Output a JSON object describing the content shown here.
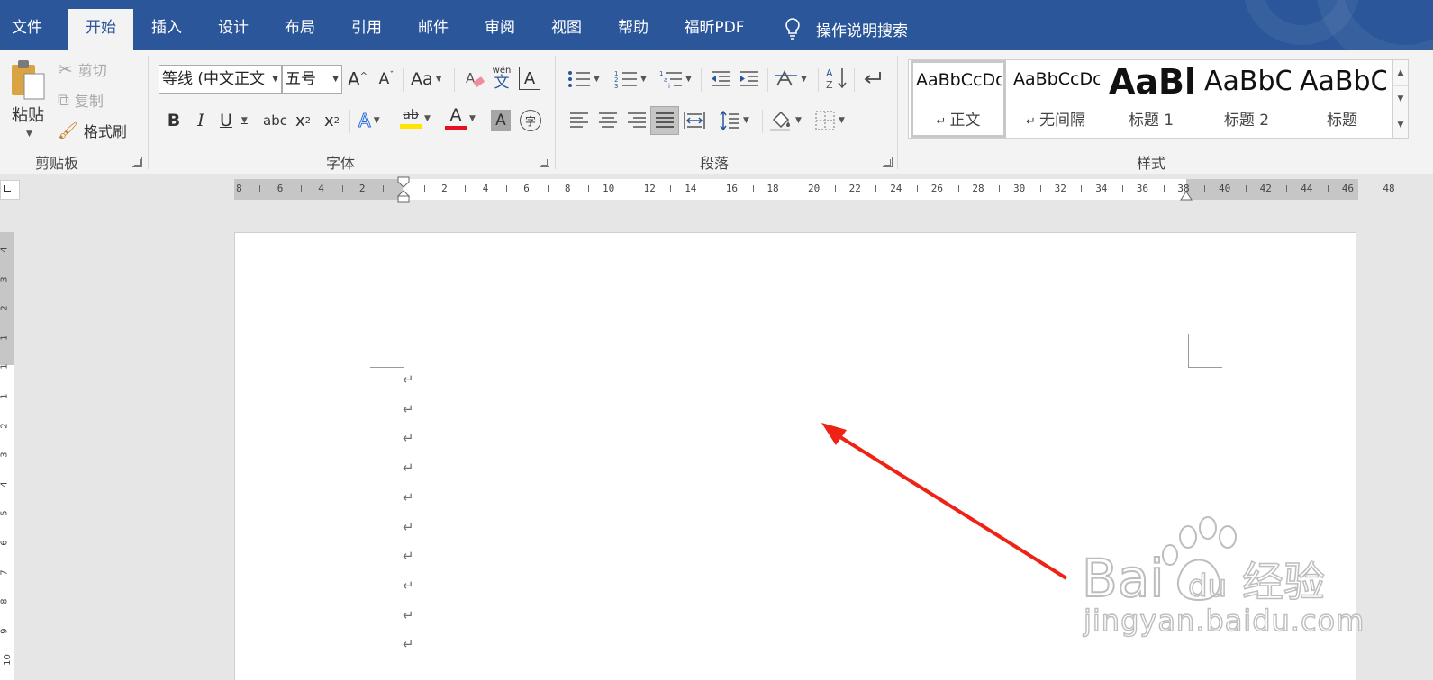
{
  "menu": {
    "tabs": [
      "文件",
      "开始",
      "插入",
      "设计",
      "布局",
      "引用",
      "邮件",
      "审阅",
      "视图",
      "帮助",
      "福昕PDF"
    ],
    "active": "开始",
    "tell_me": "操作说明搜索"
  },
  "clipboard": {
    "paste": "粘贴",
    "cut": "剪切",
    "copy": "复制",
    "format_painter": "格式刷",
    "group": "剪贴板"
  },
  "font": {
    "name": "等线 (中文正文",
    "size": "五号",
    "buttons": {
      "bold": "B",
      "italic": "I",
      "underline": "U",
      "strike": "abc",
      "sub": "x",
      "sup": "x",
      "case": "Aa",
      "pinyin_top": "wén",
      "pinyin_bottom": "文",
      "border": "A",
      "effects": "A",
      "highlight": "ab",
      "color": "A",
      "shading": "A",
      "enclose": "字"
    },
    "group": "字体"
  },
  "paragraph": {
    "group": "段落"
  },
  "styles": {
    "items": [
      {
        "preview": "AaBbCcDc",
        "name": "正文",
        "selected": true
      },
      {
        "preview": "AaBbCcDc",
        "name": "无间隔"
      },
      {
        "preview": "AaBl",
        "name": "标题 1"
      },
      {
        "preview": "AaBbC",
        "name": "标题 2"
      },
      {
        "preview": "AaBbC",
        "name": "标题"
      }
    ],
    "group": "样式"
  },
  "ruler": {
    "numbers": [
      "8",
      "6",
      "4",
      "2",
      "2",
      "4",
      "6",
      "8",
      "10",
      "12",
      "14",
      "16",
      "18",
      "20",
      "22",
      "24",
      "26",
      "28",
      "30",
      "32",
      "34",
      "36",
      "38",
      "40",
      "42",
      "44",
      "46",
      "48"
    ],
    "vertical_numbers": [
      "4",
      "3",
      "2",
      "1",
      "1",
      "1",
      "2",
      "3",
      "4",
      "5",
      "6",
      "7",
      "8",
      "9",
      "10"
    ]
  },
  "document": {
    "paragraph_mark": "↵",
    "paragraph_count": 10
  },
  "colors": {
    "menubar": "#2b579a",
    "highlight": "#ffe400",
    "font_color": "#e81123",
    "arrow": "#ee2316"
  },
  "watermark": {
    "logo_text": "Bai du 经验",
    "url": "jingyan.baidu.com"
  }
}
